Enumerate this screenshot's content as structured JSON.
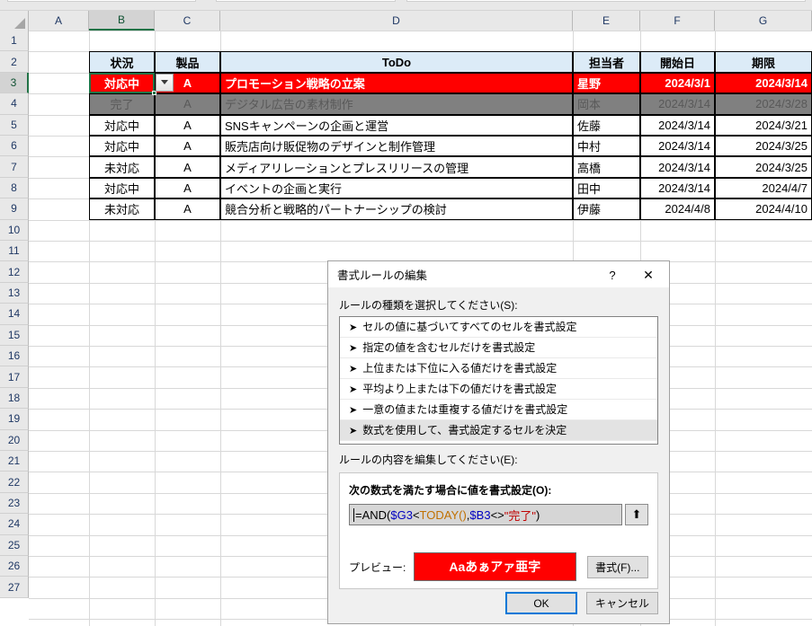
{
  "spreadsheet": {
    "column_headers": [
      "A",
      "B",
      "C",
      "D",
      "E",
      "F",
      "G"
    ],
    "selected_column": "B",
    "selected_cell": "B3",
    "row_numbers": [
      "1",
      "2",
      "3",
      "4",
      "5",
      "6",
      "7",
      "8",
      "9",
      "10",
      "11",
      "12",
      "13",
      "14",
      "15",
      "16",
      "17",
      "18",
      "19",
      "20",
      "21",
      "22",
      "23",
      "24",
      "25",
      "26",
      "27"
    ],
    "table_headers": {
      "status": "状況",
      "product": "製品",
      "todo": "ToDo",
      "owner": "担当者",
      "start": "開始日",
      "due": "期限"
    },
    "rows": [
      {
        "status": "対応中",
        "product": "A",
        "todo": "プロモーション戦略の立案",
        "owner": "星野",
        "start": "2024/3/1",
        "due": "2024/3/14",
        "style": "red"
      },
      {
        "status": "完了",
        "product": "A",
        "todo": "デジタル広告の素材制作",
        "owner": "岡本",
        "start": "2024/3/14",
        "due": "2024/3/28",
        "style": "gray"
      },
      {
        "status": "対応中",
        "product": "A",
        "todo": "SNSキャンペーンの企画と運営",
        "owner": "佐藤",
        "start": "2024/3/14",
        "due": "2024/3/21",
        "style": "plain"
      },
      {
        "status": "対応中",
        "product": "A",
        "todo": "販売店向け販促物のデザインと制作管理",
        "owner": "中村",
        "start": "2024/3/14",
        "due": "2024/3/25",
        "style": "plain"
      },
      {
        "status": "未対応",
        "product": "A",
        "todo": "メディアリレーションとプレスリリースの管理",
        "owner": "高橋",
        "start": "2024/3/14",
        "due": "2024/3/25",
        "style": "plain"
      },
      {
        "status": "対応中",
        "product": "A",
        "todo": "イベントの企画と実行",
        "owner": "田中",
        "start": "2024/3/14",
        "due": "2024/4/7",
        "style": "plain"
      },
      {
        "status": "未対応",
        "product": "A",
        "todo": "競合分析と戦略的パートナーシップの検討",
        "owner": "伊藤",
        "start": "2024/4/8",
        "due": "2024/4/10",
        "style": "plain"
      }
    ]
  },
  "dialog": {
    "title": "書式ルールの編集",
    "help_glyph": "?",
    "close_glyph": "✕",
    "rule_type_label": "ルールの種類を選択してください(S):",
    "rule_types": [
      "セルの値に基づいてすべてのセルを書式設定",
      "指定の値を含むセルだけを書式設定",
      "上位または下位に入る値だけを書式設定",
      "平均より上または下の値だけを書式設定",
      "一意の値または重複する値だけを書式設定",
      "数式を使用して、書式設定するセルを決定"
    ],
    "selected_rule_index": 5,
    "rule_edit_label": "ルールの内容を編集してください(E):",
    "formula_label": "次の数式を満たす場合に値を書式設定(O):",
    "formula": {
      "full": "=AND($G3<TODAY(),$B3<>\"完了\")",
      "tokens": [
        {
          "text": "=AND(",
          "color": "black"
        },
        {
          "text": "$G3",
          "color": "blue"
        },
        {
          "text": "<",
          "color": "black"
        },
        {
          "text": "TODAY()",
          "color": "orange"
        },
        {
          "text": ",",
          "color": "black"
        },
        {
          "text": "$B3",
          "color": "blue"
        },
        {
          "text": "<>",
          "color": "black"
        },
        {
          "text": "\"完了\"",
          "color": "red"
        },
        {
          "text": ")",
          "color": "black"
        }
      ]
    },
    "range_button_glyph": "⬆",
    "preview_label": "プレビュー:",
    "preview_sample_text": "Aaあぁアァ亜字",
    "preview_bg_color": "#FF0000",
    "preview_text_color": "#FFFFFF",
    "format_button_label": "書式(F)...",
    "ok_label": "OK",
    "cancel_label": "キャンセル"
  }
}
